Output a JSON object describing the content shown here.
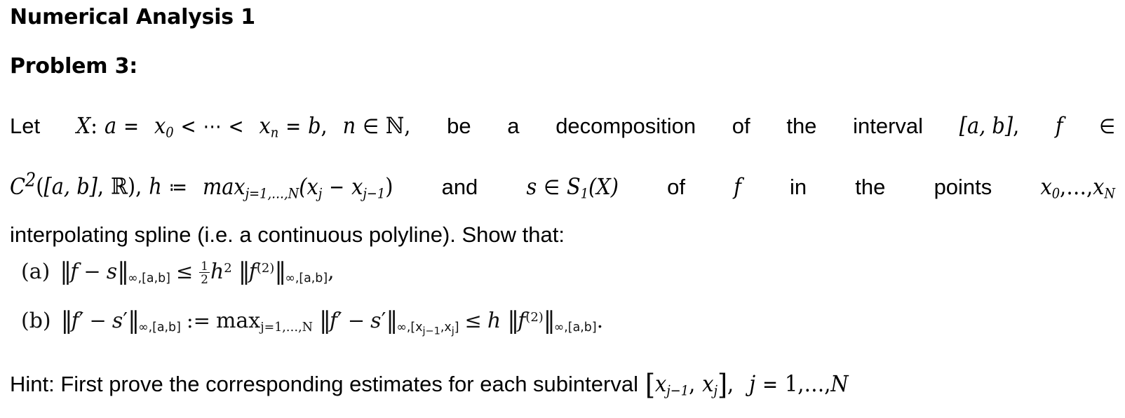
{
  "document": {
    "title": "Numerical Analysis 1",
    "problem_heading": "Problem 3:"
  },
  "body": {
    "line1": {
      "w1": "Let",
      "math_X": "X",
      "colon": ":",
      "math_a": "a",
      "eq1": "=",
      "math_x0": "x",
      "x0_sub": "0",
      "lt1": "<",
      "dots": "⋯",
      "lt2": "<",
      "math_xn": "x",
      "xn_sub": "n",
      "eq2": "=",
      "math_b": "b",
      "comma1": ",",
      "math_n": "n",
      "elem": "∈",
      "naturals": "ℕ",
      "comma2": ",",
      "w_be": "be",
      "w_a": "a",
      "w_decomposition": "decomposition",
      "w_of": "of",
      "w_the": "the",
      "w_interval": "interval",
      "interval_ab": "[a, b]",
      "comma3": ",",
      "math_f": "f",
      "elem2": "∈"
    },
    "line2": {
      "C": "C",
      "C_sup": "2",
      "paren_open": "(",
      "ab": "[a, b]",
      "comma1": ",",
      "reals": "ℝ",
      "paren_close": ")",
      "comma2": ",",
      "h": "h",
      "coloneq": "≔",
      "max": "max",
      "max_sub": "j=1,…,N",
      "expr": "(x",
      "xj_sub": "j",
      "minus": "−",
      "x2": "x",
      "xj1_sub": "j−1",
      "close": ")",
      "w_and": "and",
      "s": "s",
      "elem": "∈",
      "S": "S",
      "S_sub": "1",
      "SX": "(X)",
      "w_of": "of",
      "f": "f",
      "w_in": "in",
      "w_the": "the",
      "w_points": "points",
      "x0": "x",
      "x0_sub": "0",
      "comma3": ",",
      "ldots": "…",
      "comma4": ",",
      "xN": "x",
      "xN_sub": "N"
    },
    "line3": "interpolating spline (i.e. a continuous polyline). Show that:"
  },
  "items": {
    "a": {
      "label": "(a)",
      "latex": "‖f − s‖_{∞,[a,b]} ≤ ½ h² ‖f^{(2)}‖_{∞,[a,b]},",
      "lhs_norm_open": "‖",
      "lhs_f": "f",
      "lhs_minus": "−",
      "lhs_s": "s",
      "lhs_norm_close": "‖",
      "lhs_sub": "∞,[a,b]",
      "relation": "≤",
      "frac_num": "1",
      "frac_den": "2",
      "h": "h",
      "h_sup": "2",
      "rhs_norm_open": "‖",
      "rhs_f": "f",
      "rhs_sup": "(2)",
      "rhs_norm_close": "‖",
      "rhs_sub": "∞,[a,b]",
      "trailing": ","
    },
    "b": {
      "label": "(b)",
      "latex": "‖f′ − s′‖_{∞,[a,b]} := max_{j=1,…,N} ‖f′ − s′‖_{∞,[x_{j−1},x_j]} ≤ h ‖f^{(2)}‖_{∞,[a,b]}.",
      "n1_open": "‖",
      "n1_f": "f",
      "n1_prime": "′",
      "n1_minus": "−",
      "n1_s": "s",
      "n1_sprime": "′",
      "n1_close": "‖",
      "n1_sub": "∞,[a,b]",
      "define": ":=",
      "max": "max",
      "max_sub": "j=1,…,N",
      "n2_open": "‖",
      "n2_f": "f",
      "n2_prime": "′",
      "n2_minus": "−",
      "n2_s": "s",
      "n2_sprime": "′",
      "n2_close": "‖",
      "n2_sub_pre": "∞,[x",
      "n2_sub_j1": "j−1",
      "n2_sub_mid": ",x",
      "n2_sub_j": "j",
      "n2_sub_post": "]",
      "relation": "≤",
      "h": "h",
      "n3_open": "‖",
      "n3_f": "f",
      "n3_sup": "(2)",
      "n3_close": "‖",
      "n3_sub": "∞,[a,b]",
      "trailing": "."
    }
  },
  "hint": {
    "text": "Hint: First prove the corresponding estimates for each subinterval",
    "bracket_open": "[",
    "x_left": "x",
    "x_left_sub": "j−1",
    "comma": ",",
    "x_right": "x",
    "x_right_sub": "j",
    "bracket_close": "]",
    "comma2": ",",
    "j": "j",
    "equals": "=",
    "one": "1",
    "comma3": ",",
    "ldots": "…",
    "comma4": ",",
    "N": "N"
  },
  "colors": {
    "text": "#000000",
    "background": "#ffffff"
  }
}
